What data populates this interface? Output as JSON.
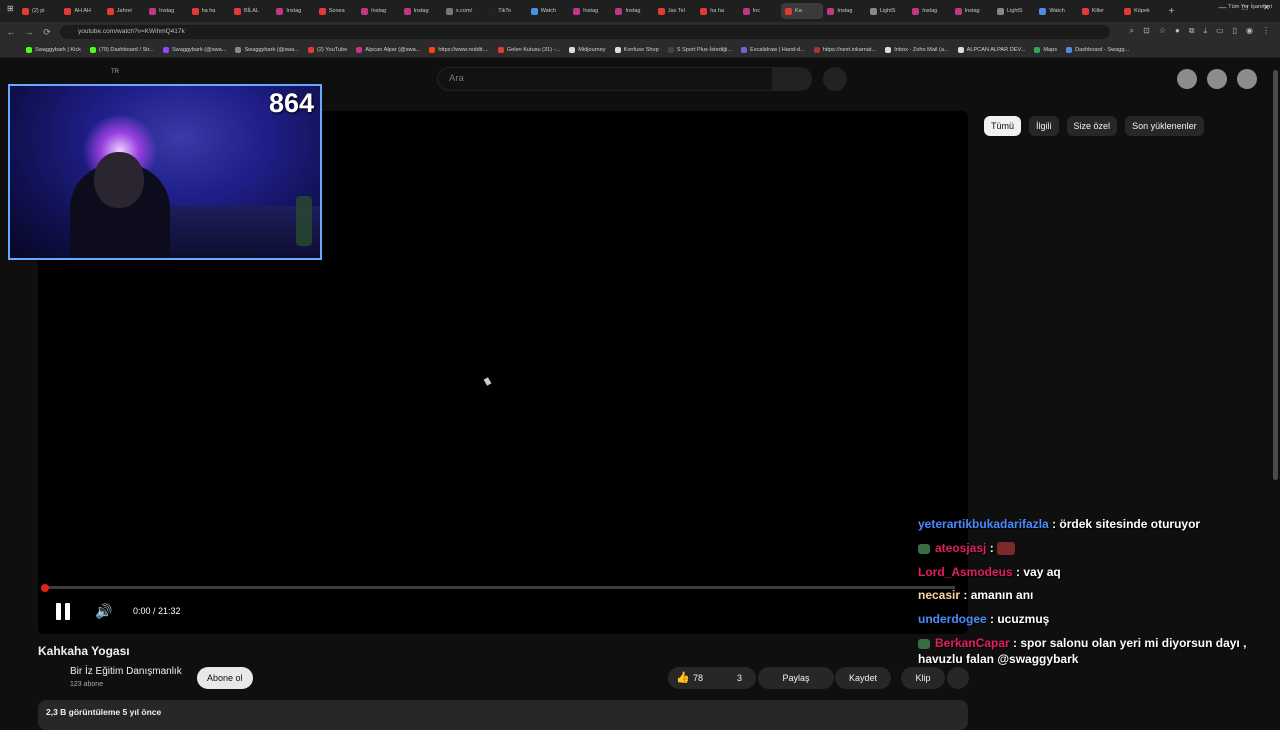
{
  "browser": {
    "tabs": [
      {
        "label": "(2) pi",
        "color": "#e53935"
      },
      {
        "label": "AH AH",
        "color": "#e53935"
      },
      {
        "label": "Jahrei",
        "color": "#e53935"
      },
      {
        "label": "Instag",
        "color": "#c13584"
      },
      {
        "label": "ha ha",
        "color": "#e53935"
      },
      {
        "label": "BİLAL",
        "color": "#e53935"
      },
      {
        "label": "Instag",
        "color": "#c13584"
      },
      {
        "label": "Sonea",
        "color": "#e53935"
      },
      {
        "label": "Instag",
        "color": "#c13584"
      },
      {
        "label": "Instag",
        "color": "#c13584"
      },
      {
        "label": "x.com/",
        "color": "#777777"
      },
      {
        "label": "TikTo",
        "color": "#222222"
      },
      {
        "label": "Watch",
        "color": "#4a90e2"
      },
      {
        "label": "Instag",
        "color": "#c13584"
      },
      {
        "label": "Instag",
        "color": "#c13584"
      },
      {
        "label": "Jax Tel",
        "color": "#e53935"
      },
      {
        "label": "ha ha",
        "color": "#e53935"
      },
      {
        "label": "Inc",
        "color": "#c13584"
      },
      {
        "label": "Ka",
        "color": "#e53935",
        "active": true
      },
      {
        "label": "Instag",
        "color": "#c13584"
      },
      {
        "label": "LightS",
        "color": "#888888"
      },
      {
        "label": "Instag",
        "color": "#c13584"
      },
      {
        "label": "Instag",
        "color": "#c13584"
      },
      {
        "label": "LightS",
        "color": "#888888"
      },
      {
        "label": "Watch",
        "color": "#4a90e2"
      },
      {
        "label": "Killer",
        "color": "#e53935"
      },
      {
        "label": "Köpek",
        "color": "#e53935"
      }
    ],
    "url": "youtube.com/watch?v=KWihmQ417k",
    "bookmarks": [
      {
        "label": "Swaggybark | Kick",
        "color": "#53fc18"
      },
      {
        "label": "(79) Dashboard / Str...",
        "color": "#53fc18"
      },
      {
        "label": "Swaggybark (@swa...",
        "color": "#9146ff"
      },
      {
        "label": "Swaggybark (@swa...",
        "color": "#888888"
      },
      {
        "label": "(2) YouTube",
        "color": "#e53935"
      },
      {
        "label": "Alpcan Alpar (@swa...",
        "color": "#c13584"
      },
      {
        "label": "https://www.reddit....",
        "color": "#ff4500"
      },
      {
        "label": "Gelen Kutusu (31) -...",
        "color": "#e53935"
      },
      {
        "label": "Midjourney",
        "color": "#dddddd"
      },
      {
        "label": "Konfuse Shop",
        "color": "#dddddd"
      },
      {
        "label": "S Sport Plus-İstediği...",
        "color": "#444444"
      },
      {
        "label": "Excalidraw | Hand-d...",
        "color": "#6965db"
      },
      {
        "label": "https://next.inkarnat...",
        "color": "#aa3333"
      },
      {
        "label": "Inbox - Zoho Mail (a...",
        "color": "#dddddd"
      },
      {
        "label": "ALPCAN ALPAR DEV...",
        "color": "#dddddd"
      },
      {
        "label": "Maps",
        "color": "#34a853"
      },
      {
        "label": "Dashboard - Swagg...",
        "color": "#4a90e2"
      }
    ],
    "bookmarks_right": "Tüm Yer İşaretleri"
  },
  "youtube": {
    "country_code": "TR",
    "search_placeholder": "Ara",
    "filter_chips": [
      "Tümü",
      "İlgili",
      "Size özel",
      "Son yüklenenler"
    ],
    "video": {
      "time": "0:00 / 21:32",
      "progress": 0,
      "title": "Kahkaha Yogası",
      "channel": "Bir İz Eğitim Danışmanlık",
      "subscribers": "123 abone",
      "subscribe_label": "Abone ol",
      "likes": "78",
      "dislikes": "3",
      "share_label": "Paylaş",
      "save_label": "Kaydet",
      "clip_label": "Klip",
      "views_date": "2,3 B görüntüleme  5 yıl önce"
    }
  },
  "overlay": {
    "counter": "864",
    "chat": [
      {
        "user": "yeterartikbukadarifazla",
        "color": "#4a8cff",
        "message": " : ördek sitesinde oturuyor",
        "badge": false
      },
      {
        "user": "ateosjasj",
        "color": "#e0205a",
        "message": " : ",
        "badge": true,
        "emote": true
      },
      {
        "user": "Lord_Asmodeus",
        "color": "#e0205a",
        "message": " : vay aq",
        "badge": false
      },
      {
        "user": "necasir",
        "color": "#f5d8a0",
        "message": " : amanın anı",
        "badge": false
      },
      {
        "user": "underdogee",
        "color": "#4a8cff",
        "message": " : ucuzmuş",
        "badge": false
      },
      {
        "user": "BerkanCapar",
        "color": "#e0205a",
        "message": " : spor salonu olan yeri mi diyorsun dayı , havuzlu falan @swaggybark",
        "badge": true
      }
    ]
  }
}
